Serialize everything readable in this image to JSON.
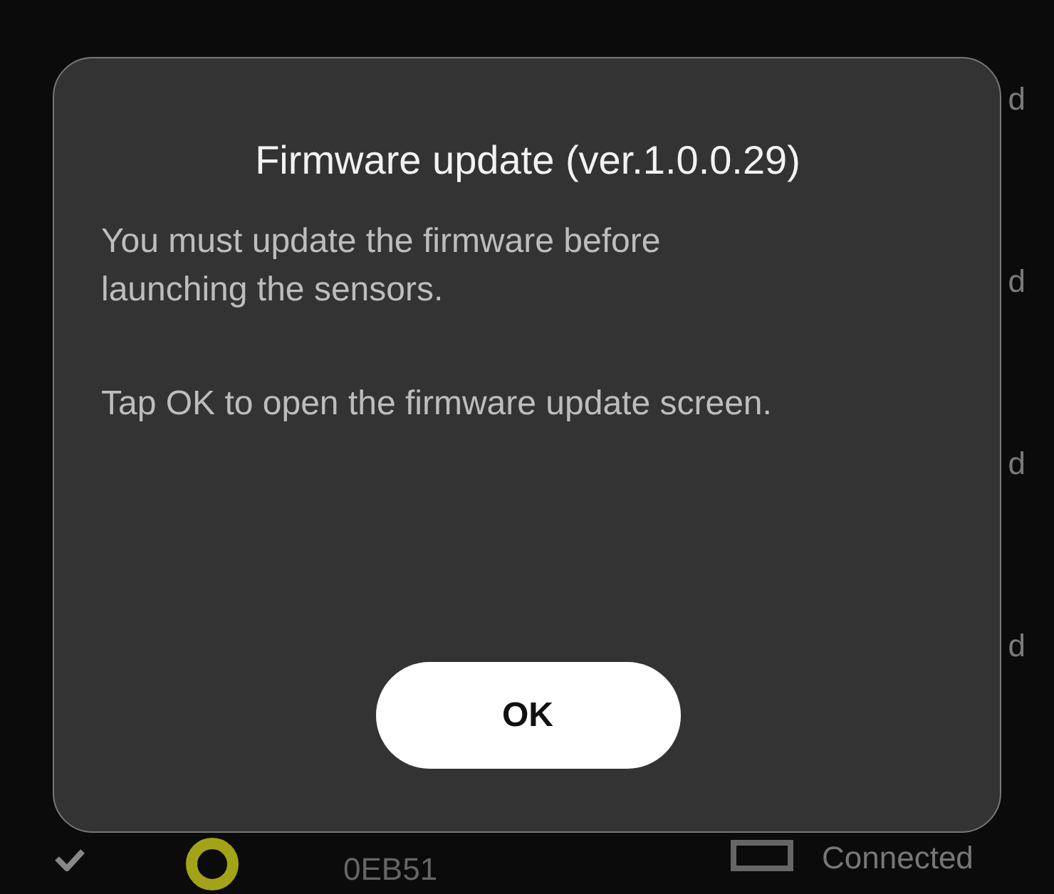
{
  "background_rows": [
    {
      "kind": "partial",
      "status": "d"
    },
    {
      "kind": "partial",
      "status": "d"
    },
    {
      "kind": "partial",
      "status": "d"
    },
    {
      "kind": "partial",
      "status": "d"
    },
    {
      "kind": "device",
      "checked": true,
      "label": "0EB51",
      "status": "Connected"
    }
  ],
  "dialog": {
    "title": "Firmware update (ver.1.0.0.29)",
    "paragraphs": [
      "You must update the firmware before launching the sensors.",
      "Tap OK to open the firmware update screen."
    ],
    "button": "OK"
  }
}
